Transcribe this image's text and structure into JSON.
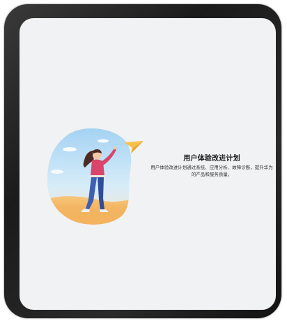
{
  "dialog": {
    "title": "用户体验改进计划",
    "description": "用户体验改进计划通过系统、应用分析、故障诊断，提升华为的产品和服务质量。"
  },
  "illustration": {
    "name": "woman-with-paper-plane-illustration"
  },
  "colors": {
    "screen_background": "#f1f2f4",
    "frame": "#1b1b1b",
    "sky": "#bfe0f6",
    "ground": "#f2b35a",
    "shirt": "#d9456b",
    "jeans": "#3d5fb4",
    "plane": "#f5c24b"
  }
}
